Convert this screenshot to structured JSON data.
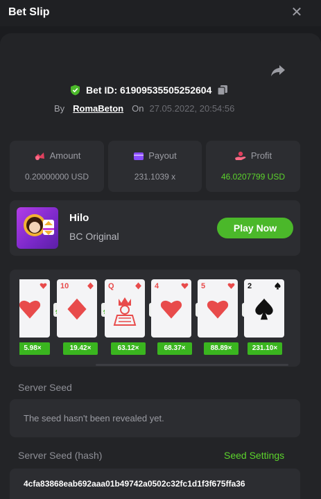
{
  "header": {
    "title": "Bet Slip",
    "close_icon": "close-icon"
  },
  "bet": {
    "id_label": "Bet ID: 6190953550525260​4",
    "by_label": "By",
    "user": "RomaBeton",
    "on_label": "On",
    "date": "27.05.2022, 20:54:56"
  },
  "stats": {
    "amount_title": "Amount",
    "amount_value": "0.20000000 USD",
    "payout_title": "Payout",
    "payout_value": "231.1039 x",
    "profit_title": "Profit",
    "profit_value": "46.0207799 USD"
  },
  "game": {
    "name": "Hilo",
    "subtitle": "BC Original",
    "play_label": "Play Now"
  },
  "cards": [
    {
      "rank": "",
      "suit": "heart",
      "multiplier": "5.98×"
    },
    {
      "rank": "10",
      "suit": "diamond",
      "multiplier": "19.42×"
    },
    {
      "rank": "Q",
      "suit": "diamond",
      "multiplier": "63.12×"
    },
    {
      "rank": "4",
      "suit": "heart",
      "multiplier": "68.37×"
    },
    {
      "rank": "5",
      "suit": "heart",
      "multiplier": "88.89×"
    },
    {
      "rank": "2",
      "suit": "spade",
      "multiplier": "231.10×"
    }
  ],
  "server_seed": {
    "label": "Server Seed",
    "value": "The seed hasn't been revealed yet."
  },
  "server_seed_hash": {
    "label": "Server Seed (hash)",
    "settings_label": "Seed Settings",
    "value": "4cfa83868eab692aaa01b49742a0502c32fc1d1f3f675ffa36"
  },
  "colors": {
    "accent_green": "#4bb82a",
    "profit_green": "#5cd32c",
    "card_red": "#e84b4b"
  }
}
